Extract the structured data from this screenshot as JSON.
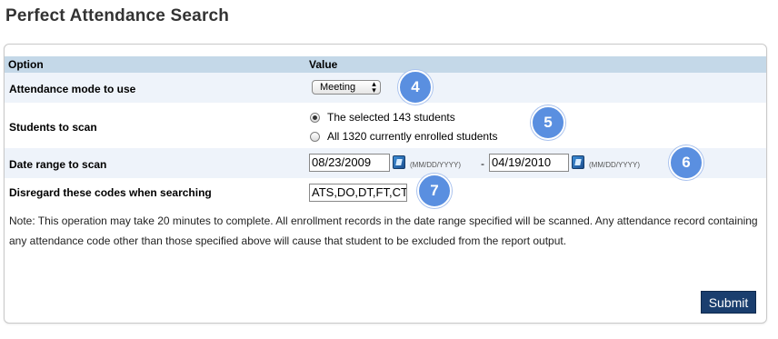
{
  "page": {
    "title": "Perfect Attendance Search"
  },
  "table": {
    "headers": {
      "option": "Option",
      "value": "Value"
    }
  },
  "rows": {
    "mode": {
      "label": "Attendance mode to use",
      "selected": "Meeting"
    },
    "students": {
      "label": "Students to scan",
      "options": [
        {
          "label": "The selected 143 students",
          "checked": true
        },
        {
          "label": "All 1320 currently enrolled students",
          "checked": false
        }
      ]
    },
    "date_range": {
      "label": "Date range to scan",
      "start": "08/23/2009",
      "end": "04/19/2010",
      "format_hint": "(MM/DD/YYYY)",
      "separator": "-"
    },
    "codes": {
      "label": "Disregard these codes when searching",
      "value": "ATS,DO,DT,FT,CT"
    }
  },
  "note": "Note: This operation may take 20 minutes to complete. All enrollment records in the date range specified will be scanned. Any attendance record containing any attendance code other than those specified above will cause that student to be excluded from the report output.",
  "submit_label": "Submit",
  "badges": {
    "b4": "4",
    "b5": "5",
    "b6": "6",
    "b7": "7"
  },
  "icons": {
    "calendar": "calendar-icon",
    "select_arrows": "updown-arrows-icon"
  },
  "colors": {
    "header_bg": "#c4d8e8",
    "alt_row_bg": "#eef3fa",
    "submit_bg": "#1a3e6e",
    "badge_bg": "#5a8fe0"
  }
}
